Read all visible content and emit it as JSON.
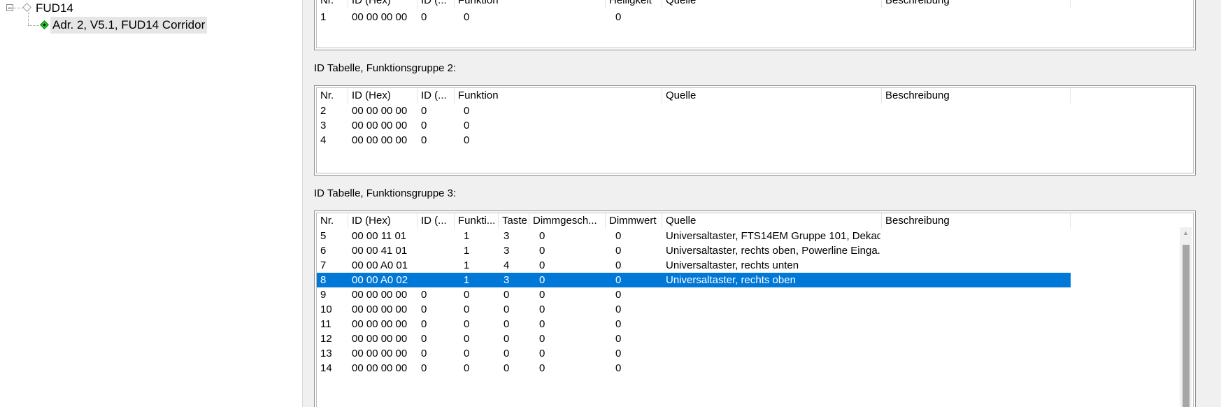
{
  "tree": {
    "device_label": "FUD14",
    "child_label": "Adr. 2, V5.1, FUD14 Corridor"
  },
  "group1": {
    "columns": [
      "Nr.",
      "ID (Hex)",
      "ID (...",
      "Funktion",
      "Helligkeit",
      "Quelle",
      "Beschreibung"
    ],
    "rows": [
      [
        "1",
        "00 00 00 00",
        "0",
        "0",
        "0",
        "",
        ""
      ]
    ]
  },
  "group2": {
    "title": "ID Tabelle, Funktionsgruppe 2:",
    "columns": [
      "Nr.",
      "ID (Hex)",
      "ID (...",
      "Funktion",
      "Quelle",
      "Beschreibung"
    ],
    "rows": [
      [
        "2",
        "00 00 00 00",
        "0",
        "0",
        "",
        ""
      ],
      [
        "3",
        "00 00 00 00",
        "0",
        "0",
        "",
        ""
      ],
      [
        "4",
        "00 00 00 00",
        "0",
        "0",
        "",
        ""
      ]
    ]
  },
  "group3": {
    "title": "ID Tabelle, Funktionsgruppe 3:",
    "columns": [
      "Nr.",
      "ID (Hex)",
      "ID (...",
      "Funkti...",
      "Taste",
      "Dimmgesch...",
      "Dimmwert",
      "Quelle",
      "Beschreibung"
    ],
    "selected_row": 3,
    "rows": [
      [
        "5",
        "00 00 11 01",
        "",
        "1",
        "3",
        "0",
        "0",
        "Universaltaster, FTS14EM Gruppe 101, Dekad...",
        ""
      ],
      [
        "6",
        "00 00 41 01",
        "",
        "1",
        "3",
        "0",
        "0",
        "Universaltaster, rechts oben, Powerline Einga...",
        ""
      ],
      [
        "7",
        "00 00 A0 01",
        "",
        "1",
        "4",
        "0",
        "0",
        "Universaltaster, rechts unten",
        ""
      ],
      [
        "8",
        "00 00 A0 02",
        "",
        "1",
        "3",
        "0",
        "0",
        "Universaltaster, rechts oben",
        ""
      ],
      [
        "9",
        "00 00 00 00",
        "0",
        "0",
        "0",
        "0",
        "0",
        "",
        ""
      ],
      [
        "10",
        "00 00 00 00",
        "0",
        "0",
        "0",
        "0",
        "0",
        "",
        ""
      ],
      [
        "11",
        "00 00 00 00",
        "0",
        "0",
        "0",
        "0",
        "0",
        "",
        ""
      ],
      [
        "12",
        "00 00 00 00",
        "0",
        "0",
        "0",
        "0",
        "0",
        "",
        ""
      ],
      [
        "13",
        "00 00 00 00",
        "0",
        "0",
        "0",
        "0",
        "0",
        "",
        ""
      ],
      [
        "14",
        "00 00 00 00",
        "0",
        "0",
        "0",
        "0",
        "0",
        "",
        ""
      ]
    ]
  },
  "colors": {
    "selection": "#0078d7",
    "pane_background": "#f0f0f0",
    "device_active_icon": "#22cc22"
  }
}
